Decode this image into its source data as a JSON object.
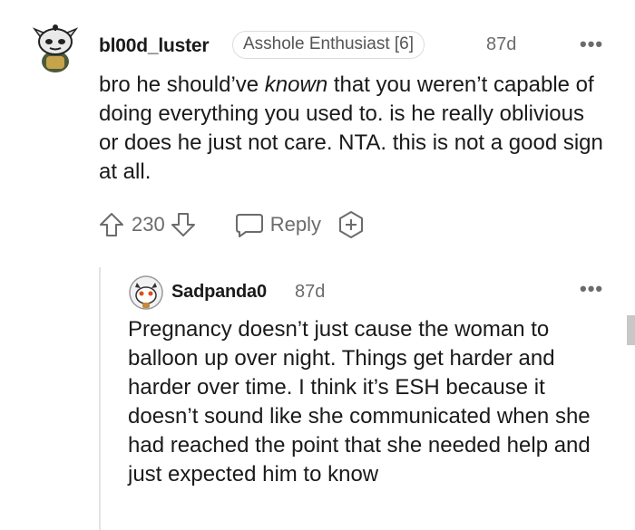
{
  "comment": {
    "username": "bl00d_luster",
    "flair": "Asshole Enthusiast [6]",
    "age": "87d",
    "more_menu": "•••",
    "body": {
      "pre": "bro he should’ve ",
      "emphasis": "known",
      "post": " that you weren’t capable of doing everything you used to. is he really oblivious or does he just not care. NTA. this is not a good sign at all."
    },
    "score": "230",
    "reply_label": "Reply",
    "icons": [
      "snoo-avatar-icon",
      "upvote-arrow-icon",
      "downvote-arrow-icon",
      "reply-bubble-icon",
      "add-award-icon"
    ]
  },
  "reply": {
    "username": "Sadpanda0",
    "age": "87d",
    "more_menu": "•••",
    "body": "Pregnancy doesn’t just cause the woman to balloon up over night. Things get harder and harder over time. I think it’s ESH because it doesn’t sound like she communicated when she had reached the point that she needed help and just expected him to know",
    "icons": [
      "snoo-avatar-icon"
    ]
  },
  "colors": {
    "text": "#1a1a1b",
    "meta": "#6b6b6b",
    "flair_border": "#dcdcdc",
    "thread_line": "#e3e3e3"
  }
}
